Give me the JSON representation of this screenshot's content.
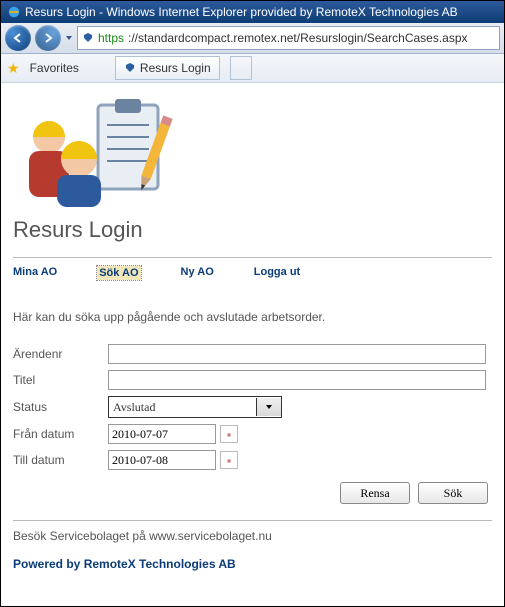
{
  "window": {
    "title": "Resurs Login - Windows Internet Explorer provided by RemoteX Technologies AB"
  },
  "addressbar": {
    "scheme": "https",
    "rest": "://standardcompact.remotex.net/Resurslogin/SearchCases.aspx"
  },
  "favbar": {
    "favorites_label": "Favorites",
    "tab_label": "Resurs Login"
  },
  "page": {
    "title": "Resurs Login"
  },
  "menu": {
    "mina_ao": "Mina AO",
    "sok_ao": "Sök AO",
    "ny_ao": "Ny AO",
    "logga_ut": "Logga ut"
  },
  "intro": "Här kan du söka upp pågående och avslutade arbetsorder.",
  "form": {
    "arendenr_label": "Ärendenr",
    "arendenr_value": "",
    "titel_label": "Titel",
    "titel_value": "",
    "status_label": "Status",
    "status_value": "Avslutad",
    "fran_label": "Från datum",
    "fran_value": "2010-07-07",
    "till_label": "Till datum",
    "till_value": "2010-07-08"
  },
  "buttons": {
    "rensa": "Rensa",
    "sok": "Sök"
  },
  "footer": {
    "text": "Besök Servicebolaget på www.servicebolaget.nu",
    "powered": "Powered by RemoteX Technologies AB"
  }
}
